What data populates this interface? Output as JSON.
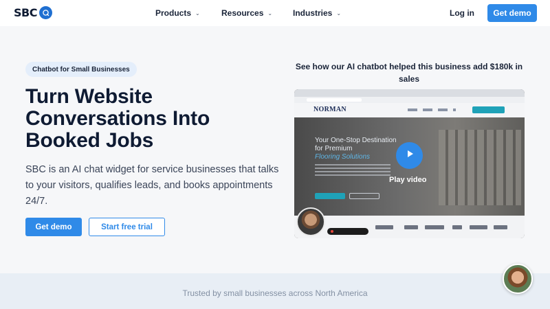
{
  "nav": {
    "logo_text": "SBC",
    "products": "Products",
    "resources": "Resources",
    "industries": "Industries",
    "login": "Log in",
    "get_demo": "Get demo"
  },
  "hero": {
    "badge": "Chatbot for Small Businesses",
    "headline": "Turn Website Conversations Into Booked Jobs",
    "subtext": "SBC is an AI chat widget for service businesses that talks to your visitors, qualifies leads, and books appointments 24/7.",
    "primary_cta": "Get demo",
    "secondary_cta": "Start free trial"
  },
  "video": {
    "heading": "See how our AI chatbot helped this business add $180k in sales",
    "play_label": "Play video",
    "thumb_brand": "NORMAN",
    "thumb_title": "Your One-Stop Destination for Premium",
    "thumb_subtitle": "Flooring Solutions"
  },
  "trusted": {
    "text": "Trusted by small businesses across North America"
  },
  "colors": {
    "accent": "#2f8ae8",
    "heading": "#0f1b33",
    "badge_bg": "#e4eefb"
  }
}
